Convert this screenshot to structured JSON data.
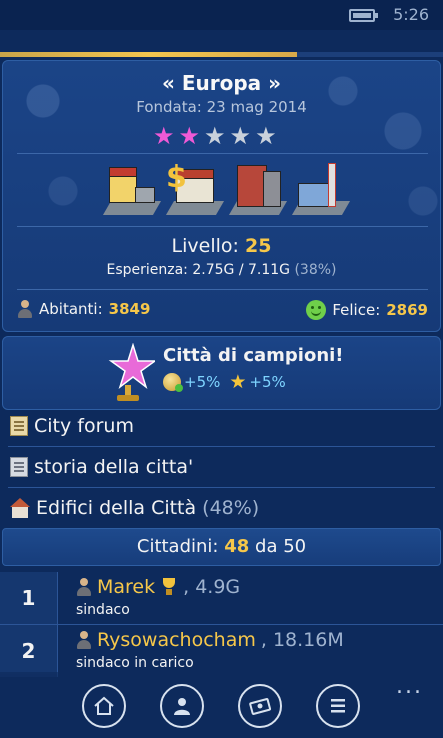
{
  "status_bar": {
    "time": "5:26",
    "icon": "battery-charging-icon"
  },
  "city": {
    "name": "« Europa »",
    "founded": "Fondata: 23 mag 2014",
    "stars": {
      "filled": 2,
      "total": 5
    },
    "buildings": [
      "garage-building-icon",
      "bank-building-icon",
      "apartment-building-icon",
      "factory-building-icon"
    ],
    "level_label": "Livello:",
    "level_value": "25",
    "experience": "Esperienza: 2.75G / 7.11G",
    "experience_pct": "(38%)",
    "inhabitants_label": "Abitanti:",
    "inhabitants_value": "3849",
    "happy_label": "Felice:",
    "happy_value": "2869"
  },
  "champions": {
    "title": "Città di campioni!",
    "bonus1": "+5%",
    "bonus2": "+5%"
  },
  "menu": {
    "forum": "City forum",
    "history": "storia della citta'",
    "buildings": "Edifici della Città",
    "buildings_pct": "(48%)"
  },
  "citizens": {
    "label": "Cittadini:",
    "count": "48",
    "suffix": "da 50",
    "list": [
      {
        "rank": "1",
        "name": "Marek",
        "score": ", 4.9G",
        "role": "sindaco"
      },
      {
        "rank": "2",
        "name": "Rysowachocham",
        "score": ", 18.16M",
        "role": "sindaco in carico"
      }
    ]
  },
  "app_bar": {
    "buttons": [
      "home-icon",
      "profile-icon",
      "money-icon",
      "list-icon"
    ],
    "more": "..."
  },
  "progress": {
    "fraction": 0.67
  },
  "colors": {
    "accent": "#f6c74a",
    "background": "#0d2a5c",
    "star_on": "#f05ad6"
  }
}
